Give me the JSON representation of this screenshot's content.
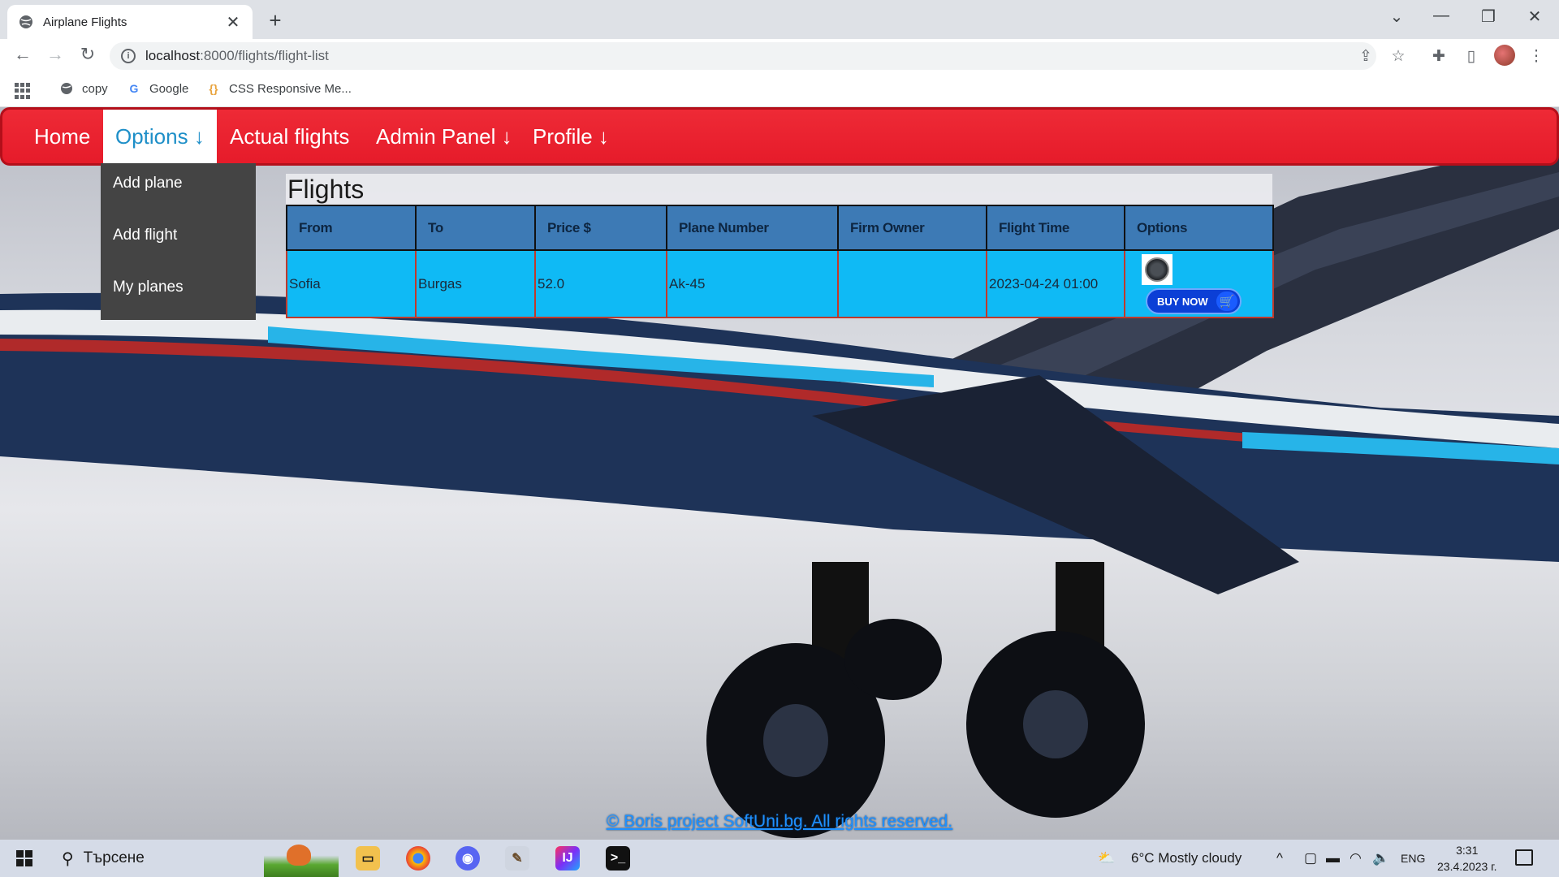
{
  "browser": {
    "tab_title": "Airplane Flights",
    "url_host": "localhost",
    "url_path": ":8000/flights/flight-list",
    "bookmarks": [
      {
        "label": "copy",
        "icon": "globe-icon"
      },
      {
        "label": "Google",
        "icon": "google-icon"
      },
      {
        "label": "CSS Responsive Me...",
        "icon": "code-brackets-icon"
      }
    ]
  },
  "nav": {
    "home": "Home",
    "options": "Options ↓",
    "actual_flights": "Actual flights",
    "admin_panel": "Admin Panel ↓",
    "profile": "Profile ↓"
  },
  "dropdown": {
    "items": [
      "Add plane",
      "Add flight",
      "My planes"
    ]
  },
  "flights": {
    "title": "Flights",
    "columns": [
      "From",
      "To",
      "Price $",
      "Plane Number",
      "Firm Owner",
      "Flight Time",
      "Options"
    ],
    "rows": [
      {
        "from": "Sofia",
        "to": "Burgas",
        "price": "52.0",
        "plane_number": "Ak-45",
        "firm_owner": "",
        "flight_time": "2023-04-24 01:00",
        "buy_label": "BUY NOW"
      }
    ]
  },
  "footer": {
    "text": "© Boris project SoftUni.bg. All rights reserved."
  },
  "taskbar": {
    "search_placeholder": "Търсене",
    "weather": "6°C  Mostly cloudy",
    "lang": "ENG",
    "time": "3:31",
    "date": "23.4.2023 г."
  },
  "colors": {
    "navbar": "#e61b2a",
    "table_header": "#3d7ab5",
    "table_row": "#0fbaf5",
    "footer_link": "#1e90ff"
  }
}
